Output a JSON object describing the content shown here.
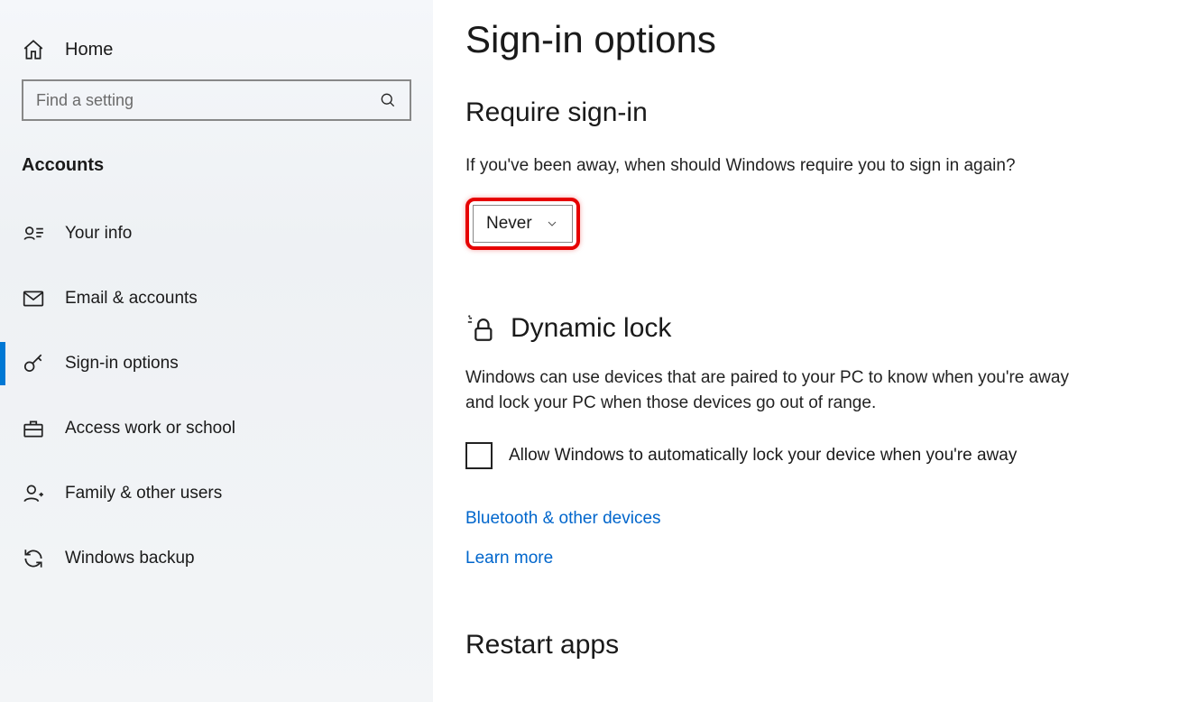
{
  "sidebar": {
    "home_label": "Home",
    "search_placeholder": "Find a setting",
    "section_label": "Accounts",
    "items": [
      {
        "label": "Your info"
      },
      {
        "label": "Email & accounts"
      },
      {
        "label": "Sign-in options"
      },
      {
        "label": "Access work or school"
      },
      {
        "label": "Family & other users"
      },
      {
        "label": "Windows backup"
      }
    ]
  },
  "main": {
    "page_title": "Sign-in options",
    "require_signin": {
      "heading": "Require sign-in",
      "description": "If you've been away, when should Windows require you to sign in again?",
      "dropdown_value": "Never"
    },
    "dynamic_lock": {
      "heading": "Dynamic lock",
      "description": "Windows can use devices that are paired to your PC to know when you're away and lock your PC when those devices go out of range.",
      "checkbox_label": "Allow Windows to automatically lock your device when you're away",
      "checkbox_checked": false,
      "link_bluetooth": "Bluetooth & other devices",
      "link_learn_more": "Learn more"
    },
    "restart_apps": {
      "heading": "Restart apps"
    }
  },
  "colors": {
    "accent": "#0078d4",
    "link": "#0066cc",
    "highlight": "#e60000"
  }
}
